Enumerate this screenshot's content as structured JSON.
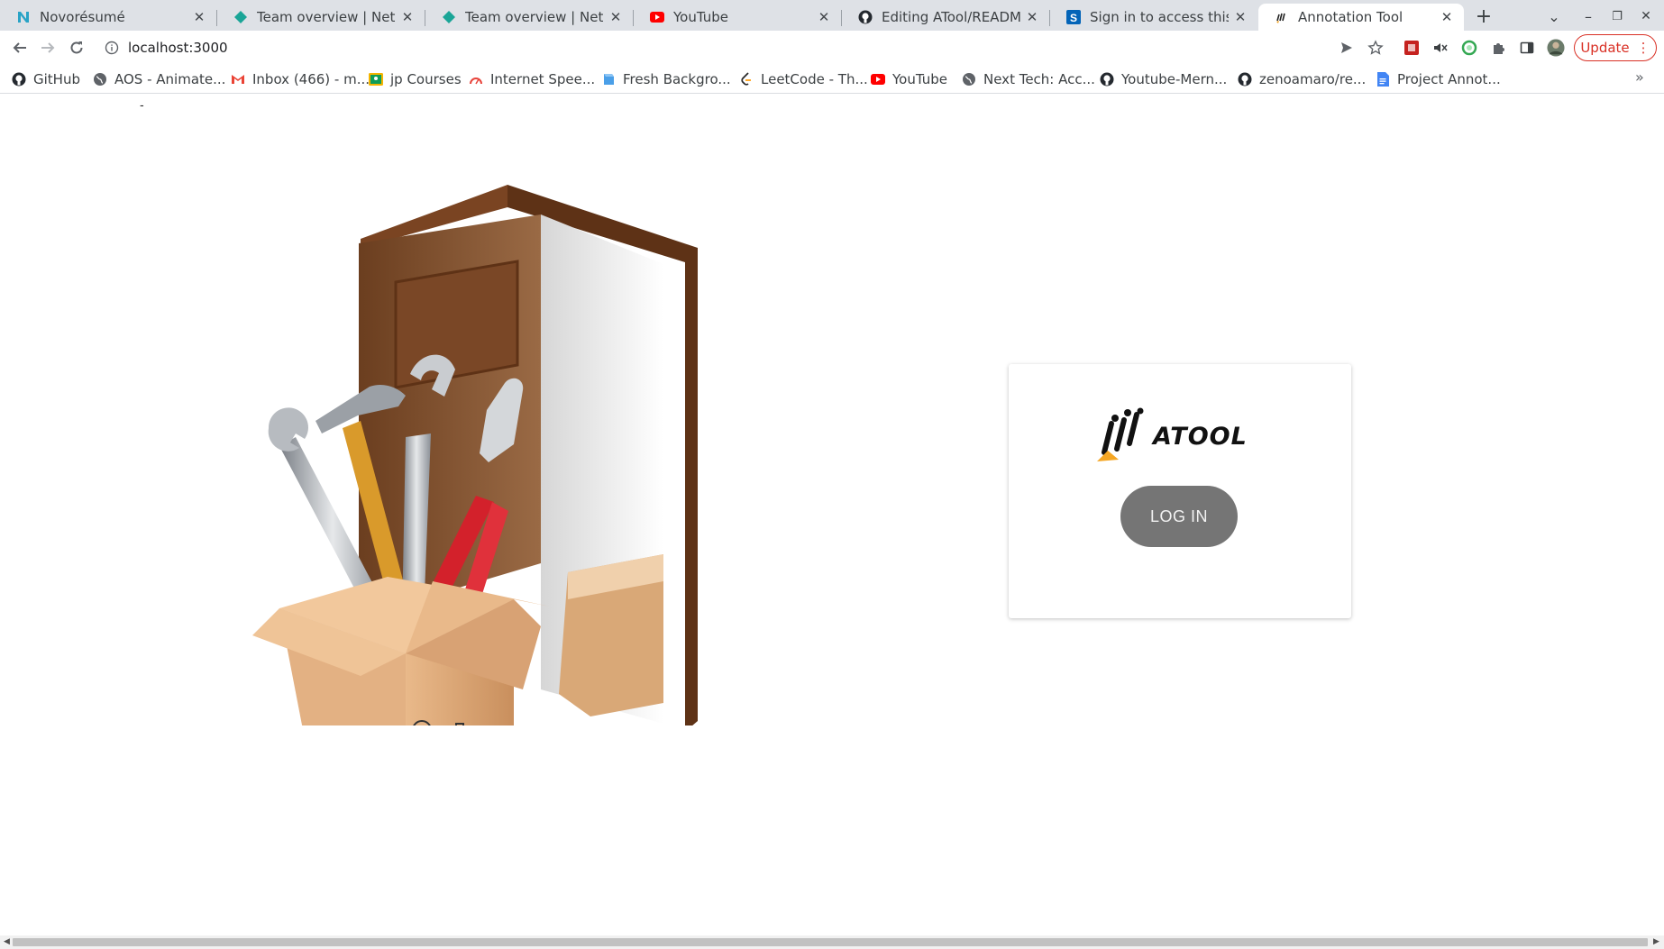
{
  "tabs": [
    {
      "title": "Novorésumé",
      "icon": "novoresume-n-icon"
    },
    {
      "title": "Team overview | Netlify",
      "icon": "netlify-icon"
    },
    {
      "title": "Team overview | Netlify",
      "icon": "netlify-icon"
    },
    {
      "title": "YouTube",
      "icon": "youtube-icon"
    },
    {
      "title": "Editing ATool/README.md",
      "icon": "github-icon"
    },
    {
      "title": "Sign in to access this net",
      "icon": "sharepoint-icon"
    },
    {
      "title": "Annotation Tool",
      "icon": "atool-favicon",
      "active": true
    }
  ],
  "tabstrip": {
    "new_tab": "+",
    "tab_search": "⌄",
    "minimize": "–",
    "restore": "❐",
    "close": "✕"
  },
  "toolbar": {
    "url": "localhost:3000",
    "update_label": "Update",
    "update_menu": "⋮"
  },
  "bookmarks": [
    {
      "label": "GitHub",
      "icon": "github-icon"
    },
    {
      "label": "AOS - Animate...",
      "icon": "globe-icon"
    },
    {
      "label": "Inbox (466) - m...",
      "icon": "gmail-icon"
    },
    {
      "label": "jp Courses",
      "icon": "classroom-icon"
    },
    {
      "label": "Internet Spee...",
      "icon": "speedtest-icon"
    },
    {
      "label": "Fresh Backgro...",
      "icon": "fresh-bg-icon"
    },
    {
      "label": "LeetCode - Th...",
      "icon": "leetcode-icon"
    },
    {
      "label": "YouTube",
      "icon": "youtube-icon"
    },
    {
      "label": "Next Tech: Acc...",
      "icon": "globe-icon"
    },
    {
      "label": "Youtube-Mern...",
      "icon": "github-icon"
    },
    {
      "label": "zenoamaro/re...",
      "icon": "github-icon"
    },
    {
      "label": "Project Annot...",
      "icon": "google-docs-icon"
    }
  ],
  "bookmarks_more": "»",
  "page": {
    "dash": "-",
    "logo_text": "ATOOL",
    "login_label": "LOG IN"
  },
  "colors": {
    "tabstrip_bg": "#dee1e6",
    "update_red": "#d93025",
    "login_button": "#757575",
    "door_brown": "#7a4a2a",
    "box_tan": "#d9a877"
  }
}
